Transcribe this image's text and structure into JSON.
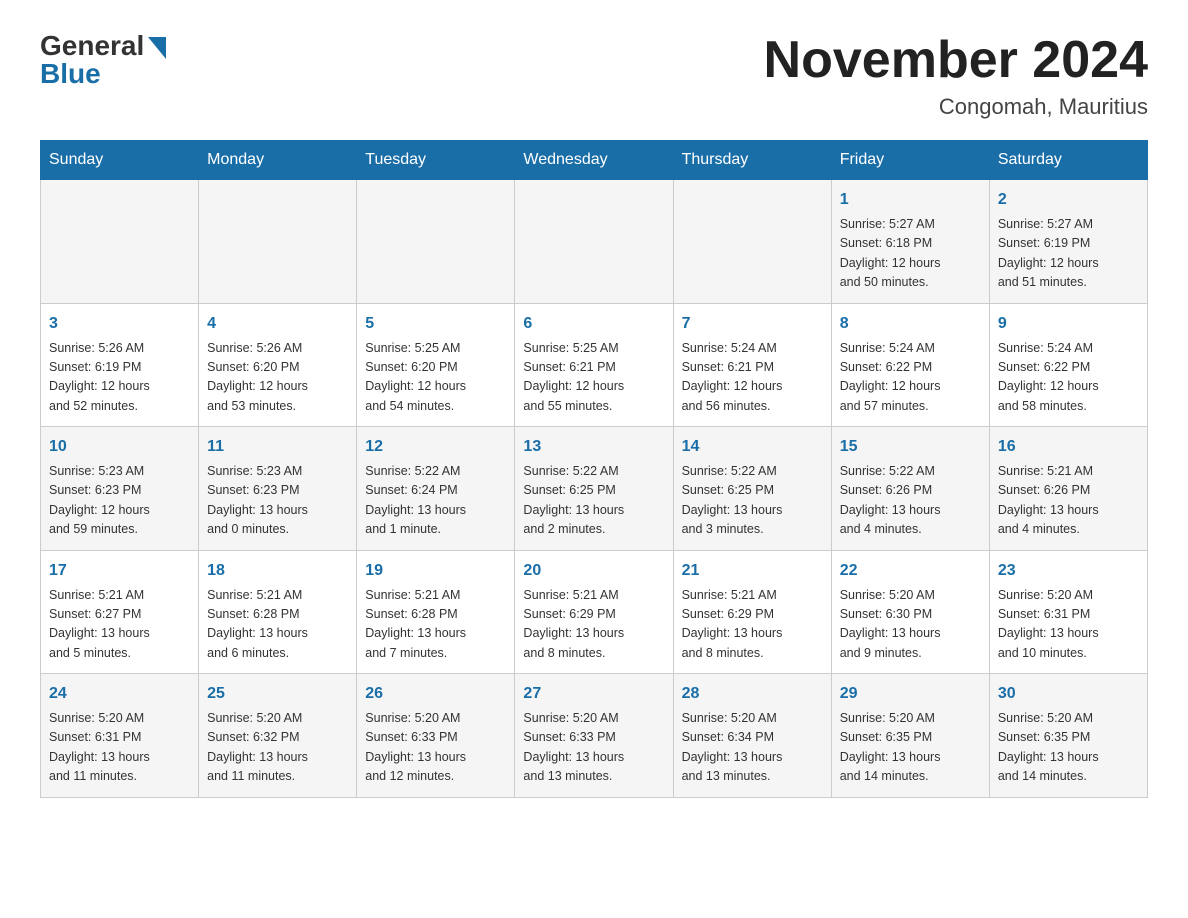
{
  "logo": {
    "general": "General",
    "blue": "Blue"
  },
  "title": {
    "month_year": "November 2024",
    "location": "Congomah, Mauritius"
  },
  "weekdays": [
    "Sunday",
    "Monday",
    "Tuesday",
    "Wednesday",
    "Thursday",
    "Friday",
    "Saturday"
  ],
  "weeks": [
    [
      {
        "day": "",
        "info": ""
      },
      {
        "day": "",
        "info": ""
      },
      {
        "day": "",
        "info": ""
      },
      {
        "day": "",
        "info": ""
      },
      {
        "day": "",
        "info": ""
      },
      {
        "day": "1",
        "info": "Sunrise: 5:27 AM\nSunset: 6:18 PM\nDaylight: 12 hours\nand 50 minutes."
      },
      {
        "day": "2",
        "info": "Sunrise: 5:27 AM\nSunset: 6:19 PM\nDaylight: 12 hours\nand 51 minutes."
      }
    ],
    [
      {
        "day": "3",
        "info": "Sunrise: 5:26 AM\nSunset: 6:19 PM\nDaylight: 12 hours\nand 52 minutes."
      },
      {
        "day": "4",
        "info": "Sunrise: 5:26 AM\nSunset: 6:20 PM\nDaylight: 12 hours\nand 53 minutes."
      },
      {
        "day": "5",
        "info": "Sunrise: 5:25 AM\nSunset: 6:20 PM\nDaylight: 12 hours\nand 54 minutes."
      },
      {
        "day": "6",
        "info": "Sunrise: 5:25 AM\nSunset: 6:21 PM\nDaylight: 12 hours\nand 55 minutes."
      },
      {
        "day": "7",
        "info": "Sunrise: 5:24 AM\nSunset: 6:21 PM\nDaylight: 12 hours\nand 56 minutes."
      },
      {
        "day": "8",
        "info": "Sunrise: 5:24 AM\nSunset: 6:22 PM\nDaylight: 12 hours\nand 57 minutes."
      },
      {
        "day": "9",
        "info": "Sunrise: 5:24 AM\nSunset: 6:22 PM\nDaylight: 12 hours\nand 58 minutes."
      }
    ],
    [
      {
        "day": "10",
        "info": "Sunrise: 5:23 AM\nSunset: 6:23 PM\nDaylight: 12 hours\nand 59 minutes."
      },
      {
        "day": "11",
        "info": "Sunrise: 5:23 AM\nSunset: 6:23 PM\nDaylight: 13 hours\nand 0 minutes."
      },
      {
        "day": "12",
        "info": "Sunrise: 5:22 AM\nSunset: 6:24 PM\nDaylight: 13 hours\nand 1 minute."
      },
      {
        "day": "13",
        "info": "Sunrise: 5:22 AM\nSunset: 6:25 PM\nDaylight: 13 hours\nand 2 minutes."
      },
      {
        "day": "14",
        "info": "Sunrise: 5:22 AM\nSunset: 6:25 PM\nDaylight: 13 hours\nand 3 minutes."
      },
      {
        "day": "15",
        "info": "Sunrise: 5:22 AM\nSunset: 6:26 PM\nDaylight: 13 hours\nand 4 minutes."
      },
      {
        "day": "16",
        "info": "Sunrise: 5:21 AM\nSunset: 6:26 PM\nDaylight: 13 hours\nand 4 minutes."
      }
    ],
    [
      {
        "day": "17",
        "info": "Sunrise: 5:21 AM\nSunset: 6:27 PM\nDaylight: 13 hours\nand 5 minutes."
      },
      {
        "day": "18",
        "info": "Sunrise: 5:21 AM\nSunset: 6:28 PM\nDaylight: 13 hours\nand 6 minutes."
      },
      {
        "day": "19",
        "info": "Sunrise: 5:21 AM\nSunset: 6:28 PM\nDaylight: 13 hours\nand 7 minutes."
      },
      {
        "day": "20",
        "info": "Sunrise: 5:21 AM\nSunset: 6:29 PM\nDaylight: 13 hours\nand 8 minutes."
      },
      {
        "day": "21",
        "info": "Sunrise: 5:21 AM\nSunset: 6:29 PM\nDaylight: 13 hours\nand 8 minutes."
      },
      {
        "day": "22",
        "info": "Sunrise: 5:20 AM\nSunset: 6:30 PM\nDaylight: 13 hours\nand 9 minutes."
      },
      {
        "day": "23",
        "info": "Sunrise: 5:20 AM\nSunset: 6:31 PM\nDaylight: 13 hours\nand 10 minutes."
      }
    ],
    [
      {
        "day": "24",
        "info": "Sunrise: 5:20 AM\nSunset: 6:31 PM\nDaylight: 13 hours\nand 11 minutes."
      },
      {
        "day": "25",
        "info": "Sunrise: 5:20 AM\nSunset: 6:32 PM\nDaylight: 13 hours\nand 11 minutes."
      },
      {
        "day": "26",
        "info": "Sunrise: 5:20 AM\nSunset: 6:33 PM\nDaylight: 13 hours\nand 12 minutes."
      },
      {
        "day": "27",
        "info": "Sunrise: 5:20 AM\nSunset: 6:33 PM\nDaylight: 13 hours\nand 13 minutes."
      },
      {
        "day": "28",
        "info": "Sunrise: 5:20 AM\nSunset: 6:34 PM\nDaylight: 13 hours\nand 13 minutes."
      },
      {
        "day": "29",
        "info": "Sunrise: 5:20 AM\nSunset: 6:35 PM\nDaylight: 13 hours\nand 14 minutes."
      },
      {
        "day": "30",
        "info": "Sunrise: 5:20 AM\nSunset: 6:35 PM\nDaylight: 13 hours\nand 14 minutes."
      }
    ]
  ]
}
